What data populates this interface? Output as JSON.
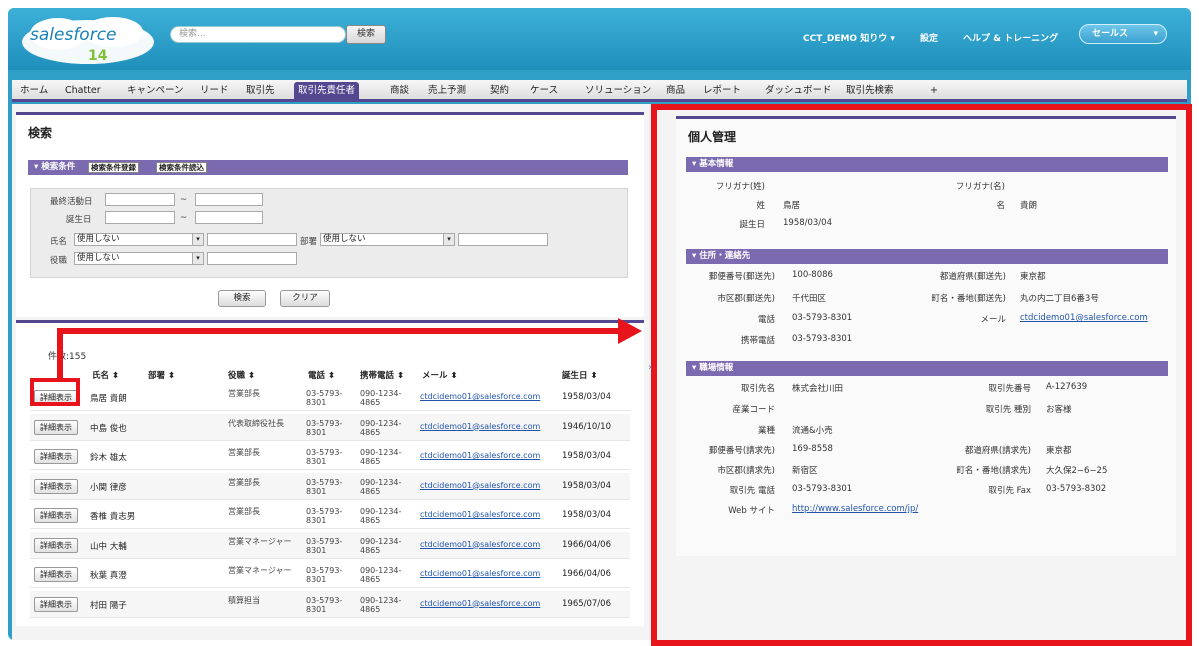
{
  "header": {
    "logo_text": "salesforce",
    "logo_version": "14",
    "search_placeholder": "検索...",
    "search_button": "検索",
    "user_menu": "CCT_DEMO 知りウ ▾",
    "setup_link": "設定",
    "help_link": "ヘルプ & トレーニング",
    "app_menu": "セールス"
  },
  "tabs": [
    "ホーム",
    "Chatter",
    "キャンペーン",
    "リード",
    "取引先",
    "取引先責任者",
    "商談",
    "売上予測",
    "契約",
    "ケース",
    "ソリューション",
    "商品",
    "レポート",
    "ダッシュボード",
    "取引先検索",
    "+"
  ],
  "search_panel": {
    "title": "検索",
    "criteria_label": "▾ 検索条件",
    "save_criteria_button": "検索条件登録",
    "load_criteria_button": "検索条件読込",
    "last_activity_label": "最終活動日",
    "birthday_label": "誕生日",
    "name_label": "氏名",
    "name_select": "使用しない",
    "dept_label": "部署",
    "dept_select": "使用しない",
    "title_label": "役職",
    "title_select": "使用しない",
    "tilde": "~",
    "search_button": "検索",
    "clear_button": "クリア"
  },
  "results": {
    "count": "件数:155",
    "columns": [
      "氏名 ⬍",
      "部署 ⬍",
      "役職 ⬍",
      "電話 ⬍",
      "携帯電話 ⬍",
      "メール ⬍",
      "誕生日 ⬍"
    ],
    "detail_label": "詳細表示",
    "rows": [
      {
        "name": "鳥居 貴朗",
        "title": "営業部長",
        "phone": "03-5793-8301",
        "mobile": "090-1234-4865",
        "email": "ctdcidemo01@salesforce.com",
        "birthday": "1958/03/04"
      },
      {
        "name": "中島 俊也",
        "title": "代表取締役社長",
        "phone": "03-5793-8301",
        "mobile": "090-1234-4865",
        "email": "ctdcidemo01@salesforce.com",
        "birthday": "1946/10/10"
      },
      {
        "name": "鈴木 雄太",
        "title": "営業部長",
        "phone": "03-5793-8301",
        "mobile": "090-1234-4865",
        "email": "ctdcidemo01@salesforce.com",
        "birthday": "1958/03/04"
      },
      {
        "name": "小関 律彦",
        "title": "営業部長",
        "phone": "03-5793-8301",
        "mobile": "090-1234-4865",
        "email": "ctdcidemo01@salesforce.com",
        "birthday": "1958/03/04"
      },
      {
        "name": "香椎 貴志男",
        "title": "営業部長",
        "phone": "03-5793-8301",
        "mobile": "090-1234-4865",
        "email": "ctdcidemo01@salesforce.com",
        "birthday": "1958/03/04"
      },
      {
        "name": "山中 大輔",
        "title": "営業マネージャー",
        "phone": "03-5793-8301",
        "mobile": "090-1234-4865",
        "email": "ctdcidemo01@salesforce.com",
        "birthday": "1966/04/06"
      },
      {
        "name": "秋葉 真澄",
        "title": "営業マネージャー",
        "phone": "03-5793-8301",
        "mobile": "090-1234-4865",
        "email": "ctdcidemo01@salesforce.com",
        "birthday": "1966/04/06"
      },
      {
        "name": "村田 陽子",
        "title": "積算担当",
        "phone": "03-5793-8301",
        "mobile": "090-1234-4865",
        "email": "ctdcidemo01@salesforce.com",
        "birthday": "1965/07/06"
      }
    ]
  },
  "detail": {
    "title": "個人管理",
    "basic_section": "▾ 基本情報",
    "furigana_last_label": "フリガナ(姓)",
    "furigana_first_label": "フリガナ(名)",
    "last_name_label": "姓",
    "last_name": "鳥居",
    "first_name_label": "名",
    "first_name": "貴朗",
    "birthday_label": "誕生日",
    "birthday": "1958/03/04",
    "address_section": "▾ 住所・連絡先",
    "postal_label": "郵便番号(郵送先)",
    "postal": "100-8086",
    "pref_label": "都道府県(郵送先)",
    "pref": "東京都",
    "city_label": "市区郡(郵送先)",
    "city": "千代田区",
    "street_label": "町名・番地(郵送先)",
    "street": "丸の内二丁目6番3号",
    "phone_label": "電話",
    "phone": "03-5793-8301",
    "email_label": "メール",
    "email": "ctdcidemo01@salesforce.com",
    "mobile_label": "携帯電話",
    "mobile": "03-5793-8301",
    "work_section": "▾ 職場情報",
    "company_label": "取引先名",
    "company": "株式会社川田",
    "account_no_label": "取引先番号",
    "account_no": "A-127639",
    "industry_code_label": "産業コード",
    "account_type_label": "取引先 種別",
    "account_type": "お客様",
    "industry_label": "業種",
    "industry": "流通&小売",
    "bill_postal_label": "郵便番号(請求先)",
    "bill_postal": "169-8558",
    "bill_pref_label": "都道府県(請求先)",
    "bill_pref": "東京都",
    "bill_city_label": "市区郡(請求先)",
    "bill_city": "新宿区",
    "bill_street_label": "町名・番地(請求先)",
    "bill_street": "大久保2−6−25",
    "acct_phone_label": "取引先 電話",
    "acct_phone": "03-5793-8301",
    "acct_fax_label": "取引先 Fax",
    "acct_fax": "03-5793-8302",
    "web_label": "Web サイト",
    "web": "http://www.salesforce.com/jp/"
  },
  "colors": {
    "header": "#2f9fc8",
    "section": "#7b6ab0",
    "tab_active": "#54468f",
    "annotation": "#e8141b"
  }
}
